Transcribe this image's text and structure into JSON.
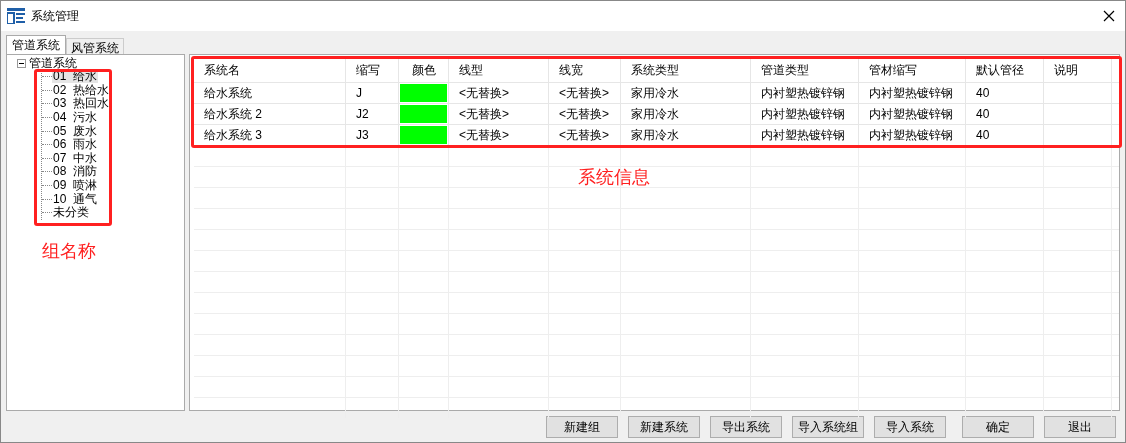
{
  "window": {
    "title": "系统管理"
  },
  "tabs": [
    {
      "label": "管道系统",
      "selected": true
    },
    {
      "label": "风管系统",
      "selected": false
    }
  ],
  "tree": {
    "label": "管道系统",
    "expanded": true,
    "children": [
      {
        "label": "01  给水",
        "selected": true
      },
      {
        "label": "02  热给水",
        "selected": false
      },
      {
        "label": "03  热回水",
        "selected": false
      },
      {
        "label": "04  污水",
        "selected": false
      },
      {
        "label": "05  废水",
        "selected": false
      },
      {
        "label": "06  雨水",
        "selected": false
      },
      {
        "label": "07  中水",
        "selected": false
      },
      {
        "label": "08  消防",
        "selected": false
      },
      {
        "label": "09  喷淋",
        "selected": false
      },
      {
        "label": "10  通气",
        "selected": false
      },
      {
        "label": "未分类",
        "selected": false
      }
    ]
  },
  "table": {
    "columns": [
      "系统名",
      "缩写",
      "颜色",
      "线型",
      "线宽",
      "系统类型",
      "管道类型",
      "管材缩写",
      "默认管径",
      "说明"
    ],
    "rows": [
      {
        "name": "给水系统",
        "abbr": "J",
        "color": "#00ff00",
        "line_type": "<无替换>",
        "line_width": "<无替换>",
        "system_type": "家用冷水",
        "pipe_type": "内衬塑热镀锌钢",
        "material": "内衬塑热镀锌钢",
        "diameter": "40"
      },
      {
        "name": "给水系统 2",
        "abbr": "J2",
        "color": "#00ff00",
        "line_type": "<无替换>",
        "line_width": "<无替换>",
        "system_type": "家用冷水",
        "pipe_type": "内衬塑热镀锌钢",
        "material": "内衬塑热镀锌钢",
        "diameter": "40"
      },
      {
        "name": "给水系统 3",
        "abbr": "J3",
        "color": "#00ff00",
        "line_type": "<无替换>",
        "line_width": "<无替换>",
        "system_type": "家用冷水",
        "pipe_type": "内衬塑热镀锌钢",
        "material": "内衬塑热镀锌钢",
        "diameter": "40"
      }
    ]
  },
  "annotations": [
    {
      "label": "组名称"
    },
    {
      "label": "系统信息"
    }
  ],
  "buttons": [
    "新建组",
    "新建系统",
    "导出系统",
    "导入系统组",
    "导入系统",
    "确定",
    "退出"
  ]
}
